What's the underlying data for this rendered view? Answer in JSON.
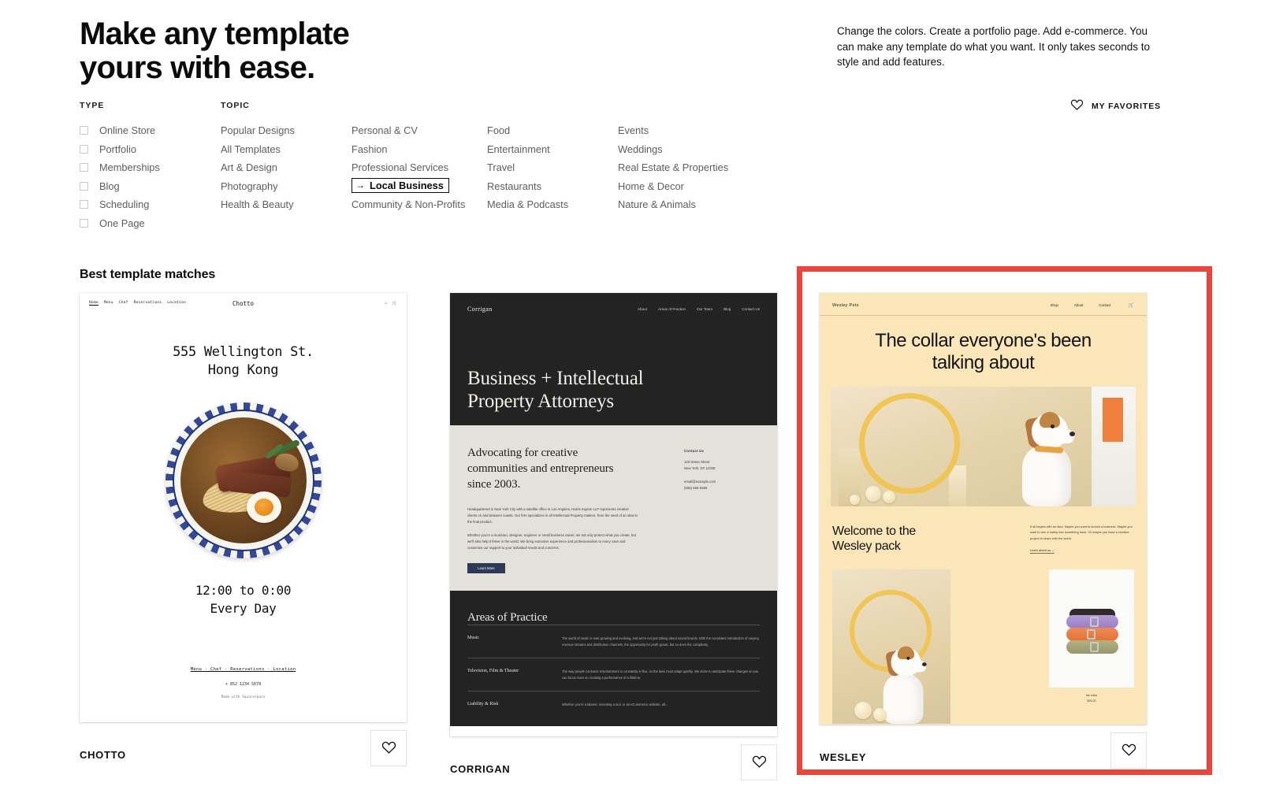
{
  "headline": "Make any template\nyours with ease.",
  "intro": "Change the colors. Create a portfolio page. Add e-commerce. You can make any template do what you want. It only takes seconds to style and add features.",
  "filters": {
    "type_label": "TYPE",
    "topic_label": "TOPIC",
    "types": [
      {
        "label": "Online Store",
        "checked": false
      },
      {
        "label": "Portfolio",
        "checked": false
      },
      {
        "label": "Memberships",
        "checked": false
      },
      {
        "label": "Blog",
        "checked": false
      },
      {
        "label": "Scheduling",
        "checked": false
      },
      {
        "label": "One Page",
        "checked": false
      }
    ],
    "topics_col1": [
      "Popular Designs",
      "All Templates",
      "Art & Design",
      "Photography",
      "Health & Beauty"
    ],
    "topics_col2": [
      "Personal & CV",
      "Fashion",
      "Professional Services",
      "Local Business",
      "Community & Non-Profits"
    ],
    "topics_col3": [
      "Food",
      "Entertainment",
      "Travel",
      "Restaurants",
      "Media & Podcasts"
    ],
    "topics_col4": [
      "Events",
      "Weddings",
      "Real Estate & Properties",
      "Home & Decor",
      "Nature & Animals"
    ],
    "highlighted_topic": "Local Business",
    "highlight_arrow": "→"
  },
  "favorites": {
    "label": "MY FAVORITES",
    "icon": "heart-icon"
  },
  "section_title": "Best template matches",
  "annotation": {
    "color": "#e8453c",
    "target": "WESLEY"
  },
  "cards": [
    {
      "name": "CHOTTO",
      "favorite_icon": "heart-icon",
      "preview": {
        "brand": "Chotto",
        "nav": [
          "Home",
          "Menu",
          "Chef",
          "Reservations",
          "Location"
        ],
        "icons": [
          "instagram-icon",
          "cart-icon"
        ],
        "address": "555 Wellington St.\nHong Kong",
        "hours": "12:00 to 0:00\nEvery Day",
        "footer_links": "Menu · Chef · Reservations · Location",
        "phone": "+ 852 1234 5678",
        "made_with": "Made with Squarespace"
      }
    },
    {
      "name": "CORRIGAN",
      "favorite_icon": "heart-icon",
      "preview": {
        "brand": "Corrigan",
        "nav": [
          "About",
          "Areas of Practice",
          "Our Team",
          "Blog",
          "Contact Us"
        ],
        "hero": "Business + Intellectual\nProperty Attorneys",
        "subhead": "Advocating for creative\ncommunities and entrepreneurs\nsince 2003.",
        "body1": "Headquartered in New York City with a satellite office in Los Angeles, Harris Ingram LLP represents creative clients on and between coasts. Our firm specializes in all Intellectual Property matters, from the seed of an idea to the final product.",
        "body2": "Whether you're a musician, designer, engineer or small business owner, we not only protect what you create, but we'll also help it thrive in the world. We bring extensive experience and professionalism to every case and customize our support to your individual needs and concerns.",
        "button": "Learn More",
        "contact_heading": "Contact Us",
        "contact_address": "123 Demo Street\nNew York, NY 12345",
        "contact_email": "email@example.com",
        "contact_phone": "(555) 555-5555",
        "practice_heading": "Areas of Practice",
        "practice_rows": [
          {
            "title": "Music",
            "text": "The world of music is ever growing and evolving, and we're not just talking about sound brands. With the consistent introduction of varying revenue streams and distribution channels, the opportunity for profit grows, but so does the complexity."
          },
          {
            "title": "Television, Film & Theater",
            "text": "The way people consume entertainment is constantly in flux, so the laws must adapt quickly. We strive to anticipate these changes so you can focus more on creating a performance of a lifetime."
          },
          {
            "title": "Liability & Risk",
            "text": "Whether you're a laborer, inventing a tool, or an eCommerce website, all..."
          }
        ]
      }
    },
    {
      "name": "WESLEY",
      "favorite_icon": "heart-icon",
      "preview": {
        "brand": "Wesley Pets",
        "nav": [
          "Shop",
          "About",
          "Contact"
        ],
        "cart_icon": "cart-icon",
        "hero": "The collar everyone's been\ntalking about",
        "welcome": "Welcome to the\nWesley pack",
        "welcome_body": "It all begins with an idea. Maybe you want to launch a business. Maybe you want to turn a hobby into something more. Or maybe you have a creative project to share with the world.",
        "welcome_link": "Learn about us →",
        "product_caption": "the collar\n$25.00"
      }
    }
  ]
}
